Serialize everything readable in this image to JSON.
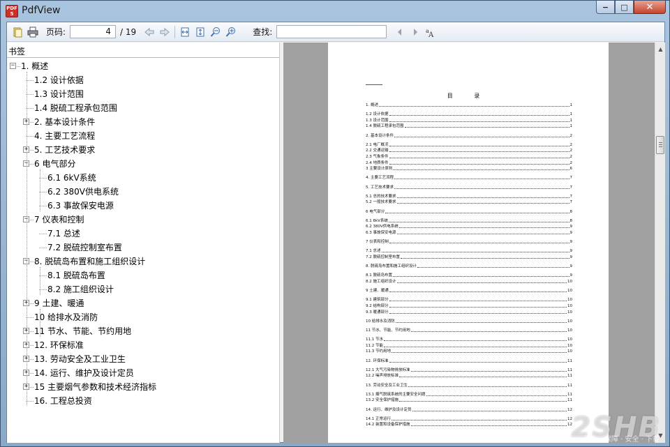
{
  "window": {
    "title": "PdfView",
    "app_icon_text": [
      "PDF",
      "5"
    ],
    "controls": {
      "minimize": "−",
      "maximize": "□",
      "close": "✕"
    }
  },
  "toolbar": {
    "page_label": "页码:",
    "page_current": "4",
    "page_total": "/ 19",
    "find_label": "查找:",
    "find_value": "",
    "icons": [
      "open-file-icon",
      "print-icon",
      "back-arrow-icon",
      "forward-arrow-icon",
      "fit-width-icon",
      "fit-page-icon",
      "zoom-out-icon",
      "zoom-in-icon",
      "find-prev-icon",
      "find-next-icon",
      "match-case-icon"
    ]
  },
  "bookmarks": {
    "header": "书签",
    "items": [
      {
        "label": "1. 概述",
        "level": 0,
        "expander": "−"
      },
      {
        "label": "1.2 设计依据",
        "level": 1,
        "expander": ""
      },
      {
        "label": "1.3 设计范围",
        "level": 1,
        "expander": ""
      },
      {
        "label": "1.4 脱硫工程承包范围",
        "level": 1,
        "expander": ""
      },
      {
        "label": "2. 基本设计条件",
        "level": 1,
        "expander": "+"
      },
      {
        "label": "4. 主要工艺流程",
        "level": 1,
        "expander": ""
      },
      {
        "label": "5. 工艺技术要求",
        "level": 1,
        "expander": "+"
      },
      {
        "label": "6 电气部分",
        "level": 1,
        "expander": "−"
      },
      {
        "label": "6.1 6kV系统",
        "level": 2,
        "expander": ""
      },
      {
        "label": "6.2 380V供电系统",
        "level": 2,
        "expander": ""
      },
      {
        "label": "6.3 事故保安电源",
        "level": 2,
        "expander": ""
      },
      {
        "label": "7 仪表和控制",
        "level": 1,
        "expander": "−"
      },
      {
        "label": "7.1 总述",
        "level": 2,
        "expander": ""
      },
      {
        "label": "7.2 脱硫控制室布置",
        "level": 2,
        "expander": ""
      },
      {
        "label": "8. 脱硫岛布置和施工组织设计",
        "level": 1,
        "expander": "−"
      },
      {
        "label": "8.1 脱硫岛布置",
        "level": 2,
        "expander": ""
      },
      {
        "label": "8.2 施工组织设计",
        "level": 2,
        "expander": ""
      },
      {
        "label": "9 土建、暖通",
        "level": 1,
        "expander": "+"
      },
      {
        "label": "10 给排水及消防",
        "level": 1,
        "expander": ""
      },
      {
        "label": "11 节水、节能、节约用地",
        "level": 1,
        "expander": "+"
      },
      {
        "label": "12. 环保标准",
        "level": 1,
        "expander": "+"
      },
      {
        "label": "13. 劳动安全及工业卫生",
        "level": 1,
        "expander": "+"
      },
      {
        "label": "14. 运行、维护及设计定员",
        "level": 1,
        "expander": "+"
      },
      {
        "label": "15 主要烟气参数和技术经济指标",
        "level": 1,
        "expander": "+"
      },
      {
        "label": "16. 工程总投资",
        "level": 1,
        "expander": ""
      }
    ]
  },
  "document": {
    "toc_title": "目 录",
    "toc_rows": [
      {
        "t": "1.  概述",
        "p": "1"
      },
      {
        "t": "1.2 设计依据",
        "p": "1"
      },
      {
        "t": "1.3 设计范围",
        "p": "1"
      },
      {
        "t": "1.4 脱硫工程承包范围",
        "p": "1"
      },
      {
        "t": "2.  基本设计条件",
        "p": "2"
      },
      {
        "t": "2.1  电厂概况",
        "p": "2"
      },
      {
        "t": "2.2  交通运输",
        "p": "2"
      },
      {
        "t": "2.3  气象条件",
        "p": "2"
      },
      {
        "t": "2.4  地质条件",
        "p": "2"
      },
      {
        "t": "3 主要设计原则",
        "p": "6"
      },
      {
        "t": "4.  主要工艺流程",
        "p": "7"
      },
      {
        "t": "5.  工艺技术要求",
        "p": "7"
      },
      {
        "t": "5.1 总的技术要求",
        "p": "7"
      },
      {
        "t": "5.2 一般技术要求",
        "p": "7"
      },
      {
        "t": "6  电气部分",
        "p": "8"
      },
      {
        "t": "6.1  6kV系统",
        "p": "8"
      },
      {
        "t": "6.2 380V供电系统",
        "p": "9"
      },
      {
        "t": "6.3  事故保安电源",
        "p": "9"
      },
      {
        "t": "7 仪表和控制",
        "p": "9"
      },
      {
        "t": "7.1 总述",
        "p": "9"
      },
      {
        "t": "7.2 脱硫控制室布置",
        "p": "9"
      },
      {
        "t": "8.  脱硫岛布置和施工组织设计",
        "p": "9"
      },
      {
        "t": "8.1 脱硫岛布置",
        "p": "9"
      },
      {
        "t": "8.2 施工组织设计",
        "p": "10"
      },
      {
        "t": "9 土建、暖通",
        "p": "10"
      },
      {
        "t": "9.1 建筑部分",
        "p": "10"
      },
      {
        "t": "9.2 结构部分",
        "p": "10"
      },
      {
        "t": "9.3 暖通部分",
        "p": "10"
      },
      {
        "t": "10 给排水及消防",
        "p": "10"
      },
      {
        "t": "11  节水、节能、节约用地",
        "p": "10"
      },
      {
        "t": "11.1 节水",
        "p": "10"
      },
      {
        "t": "11.2 节能",
        "p": "10"
      },
      {
        "t": "11.3 节约用地",
        "p": "10"
      },
      {
        "t": "12.  环保标准",
        "p": "11"
      },
      {
        "t": "12.1  大气污染物排放标准",
        "p": "11"
      },
      {
        "t": "12.2 噪声排放标准",
        "p": "11"
      },
      {
        "t": "13.  劳动安全及工业卫生",
        "p": "11"
      },
      {
        "t": "13.1  烟气脱硫系统的主要安全问题",
        "p": "11"
      },
      {
        "t": "13.2  安全保护措施",
        "p": "11"
      },
      {
        "t": "14.  运行、维护及设计定员",
        "p": "12"
      },
      {
        "t": "14.1  正常运行",
        "p": "12"
      },
      {
        "t": "14.2 装置和设备保护措施",
        "p": "12"
      }
    ]
  },
  "watermark": {
    "text": "2SHB",
    "sub": "绿色 · 保障 · 安全 · 下载"
  }
}
